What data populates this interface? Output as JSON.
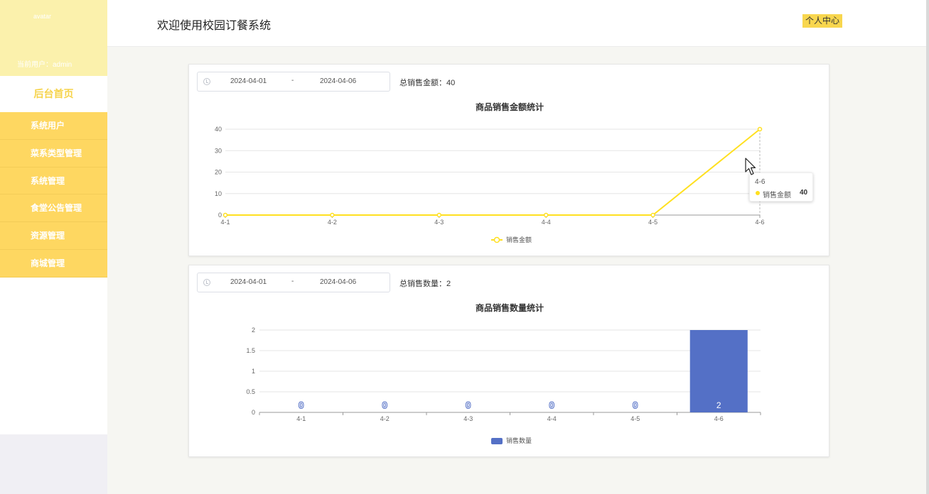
{
  "sidebar": {
    "avatar_alt": "avatar",
    "current_user": "当前用户：admin",
    "home": "后台首页",
    "items": [
      "系统用户",
      "菜系类型管理",
      "系统管理",
      "食堂公告管理",
      "资源管理",
      "商城管理"
    ]
  },
  "header": {
    "title": "欢迎使用校园订餐系统",
    "personal_center": "个人中心"
  },
  "colors": {
    "accent": "#fed761",
    "line": "#ffe020",
    "bar": "#5470c6"
  },
  "sales_amount": {
    "date_start": "2024-04-01",
    "date_sep": "-",
    "date_end": "2024-04-06",
    "total_label": "总销售金额：40",
    "tooltip": {
      "title": "4-6",
      "label": "销售金额",
      "value": "40"
    }
  },
  "sales_count": {
    "date_start": "2024-04-01",
    "date_sep": "-",
    "date_end": "2024-04-06",
    "total_label": "总销售数量：2"
  },
  "chart_data": [
    {
      "type": "line",
      "title": "商品销售金额统计",
      "categories": [
        "4-1",
        "4-2",
        "4-3",
        "4-4",
        "4-5",
        "4-6"
      ],
      "series": [
        {
          "name": "销售金额",
          "values": [
            0,
            0,
            0,
            0,
            0,
            40
          ]
        }
      ],
      "yticks": [
        "0",
        "10",
        "20",
        "30",
        "40"
      ],
      "ylim": [
        0,
        40
      ],
      "legend": "bottom-center",
      "grid": true
    },
    {
      "type": "bar",
      "title": "商品销售数量统计",
      "categories": [
        "4-1",
        "4-2",
        "4-3",
        "4-4",
        "4-5",
        "4-6"
      ],
      "series": [
        {
          "name": "销售数量",
          "values": [
            0,
            0,
            0,
            0,
            0,
            2
          ]
        }
      ],
      "yticks": [
        "0",
        "0.5",
        "1",
        "1.5",
        "2"
      ],
      "ylim": [
        0,
        2
      ],
      "data_labels": [
        "0",
        "0",
        "0",
        "0",
        "0",
        "2"
      ],
      "legend": "bottom-center",
      "grid": true
    }
  ]
}
